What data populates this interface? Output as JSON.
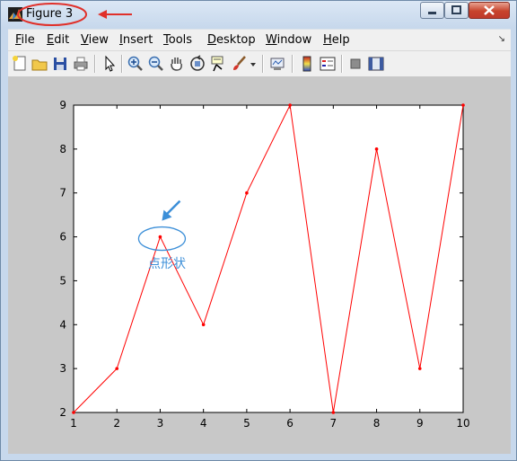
{
  "window": {
    "title": "Figure 3",
    "accent_title_mark_color": "#e0302a",
    "icons": {
      "app": "matlab-logo-icon",
      "minimize": "minimize-icon",
      "maximize": "maximize-icon",
      "close": "close-icon"
    }
  },
  "menu": {
    "items": [
      {
        "label": "File",
        "key": "F"
      },
      {
        "label": "Edit",
        "key": "E"
      },
      {
        "label": "View",
        "key": "V"
      },
      {
        "label": "Insert",
        "key": "I"
      },
      {
        "label": "Tools",
        "key": "T"
      },
      {
        "label": "Desktop",
        "key": "D"
      },
      {
        "label": "Window",
        "key": "W"
      },
      {
        "label": "Help",
        "key": "H"
      }
    ],
    "overflow_icon": "dock-arrow-icon"
  },
  "toolbar": {
    "buttons": [
      "new-figure-icon",
      "open-file-icon",
      "save-icon",
      "print-icon",
      "select-arrow-icon",
      "zoom-in-icon",
      "zoom-out-icon",
      "pan-hand-icon",
      "rotate-3d-icon",
      "data-cursor-icon",
      "brush-icon",
      "link-plot-icon",
      "colorbar-icon",
      "legend-icon",
      "hide-plot-tools-icon",
      "show-plot-tools-icon"
    ]
  },
  "chart_data": {
    "type": "line",
    "x": [
      1,
      2,
      3,
      4,
      5,
      6,
      7,
      8,
      9,
      10
    ],
    "series": [
      {
        "values": [
          2,
          3,
          6,
          4,
          7,
          9,
          2,
          8,
          3,
          9
        ],
        "color": "#ff0000",
        "marker": "point"
      }
    ],
    "xlim": [
      1,
      10
    ],
    "ylim": [
      2,
      9
    ],
    "xticks": [
      1,
      2,
      3,
      4,
      5,
      6,
      7,
      8,
      9,
      10
    ],
    "yticks": [
      2,
      3,
      4,
      5,
      6,
      7,
      8,
      9
    ],
    "grid": false,
    "title": "",
    "xlabel": "",
    "ylabel": ""
  },
  "annotation": {
    "text": "点形状",
    "color": "#3c8fd8",
    "target_x": 3,
    "target_y": 6
  }
}
